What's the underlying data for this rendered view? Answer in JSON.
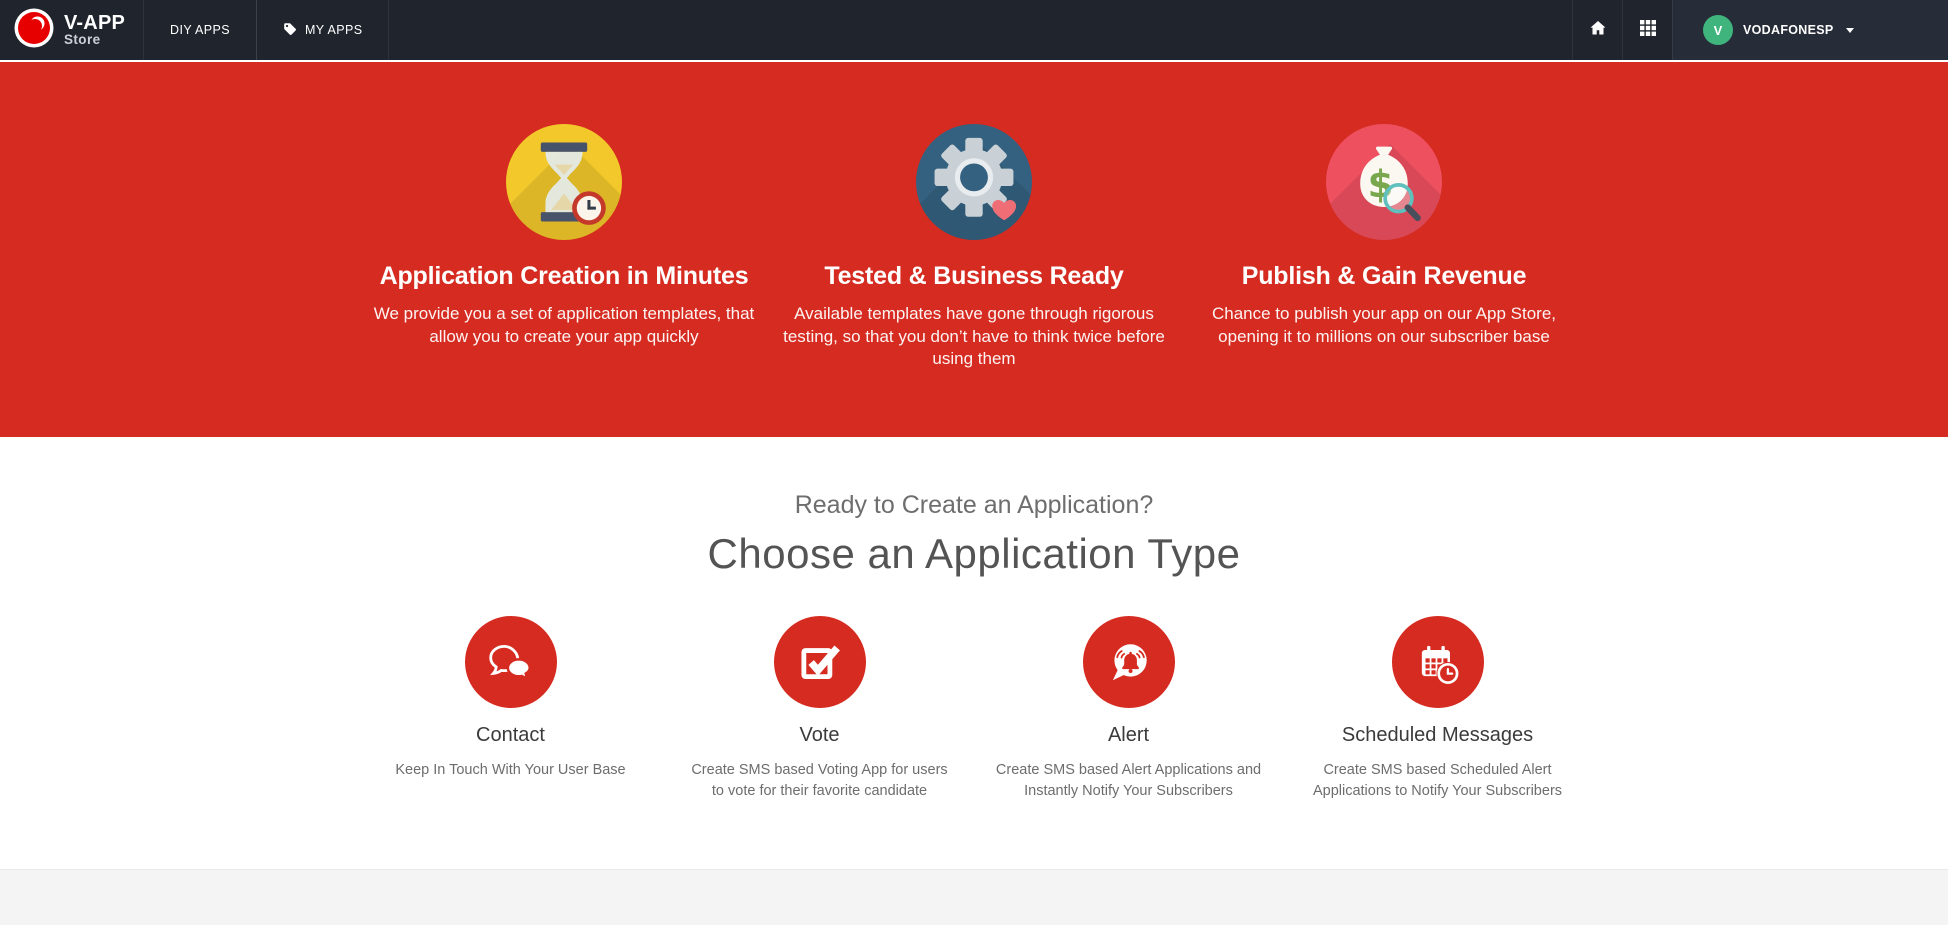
{
  "colors": {
    "navbar_bg": "#1f242d",
    "navbar_user_bg": "#272d38",
    "hero_red": "#d62b20",
    "icon_yellow": "#f2c82a",
    "icon_blue": "#33617f",
    "icon_pink": "#ee5060",
    "avatar_green": "#3fb57d",
    "vodafone_red": "#e60000",
    "footer_gray": "#f4f4f4"
  },
  "navbar": {
    "brand": {
      "icon": "vodafone-logo-icon",
      "title": "V-APP",
      "subtitle": "Store"
    },
    "links": [
      {
        "label": "DIY APPS"
      },
      {
        "label": "MY APPS",
        "icon": "tag-icon"
      }
    ],
    "actions": [
      {
        "icon": "home-icon"
      },
      {
        "icon": "apps-grid-icon"
      }
    ],
    "user": {
      "initial": "V",
      "name": "VODAFONESP",
      "icon": "caret-down-icon"
    }
  },
  "hero": {
    "features": [
      {
        "icon": "hourglass-clock-icon",
        "title": "Application Creation in Minutes",
        "description": "We provide you a set of application templates, that allow you to create your app quickly"
      },
      {
        "icon": "gear-heart-icon",
        "title": "Tested & Business Ready",
        "description": "Available templates have gone through rigorous testing, so that you don’t have to think twice before using them"
      },
      {
        "icon": "money-bag-icon",
        "title": "Publish & Gain Revenue",
        "description": "Chance to publish your app on our App Store, opening it to millions on our subscriber base"
      }
    ]
  },
  "choose": {
    "subtitle": "Ready to Create an Application?",
    "title": "Choose an Application Type",
    "types": [
      {
        "icon": "chat-bubbles-icon",
        "label": "Contact",
        "description": "Keep In Touch With Your User Base"
      },
      {
        "icon": "checkbox-check-icon",
        "label": "Vote",
        "description": "Create SMS based Voting App for users to vote for their favorite candidate"
      },
      {
        "icon": "alert-bell-icon",
        "label": "Alert",
        "description": "Create SMS based Alert Applications and Instantly Notify Your Subscribers"
      },
      {
        "icon": "calendar-clock-icon",
        "label": "Scheduled Messages",
        "description": "Create SMS based Scheduled Alert Applications to Notify Your Subscribers"
      }
    ]
  }
}
